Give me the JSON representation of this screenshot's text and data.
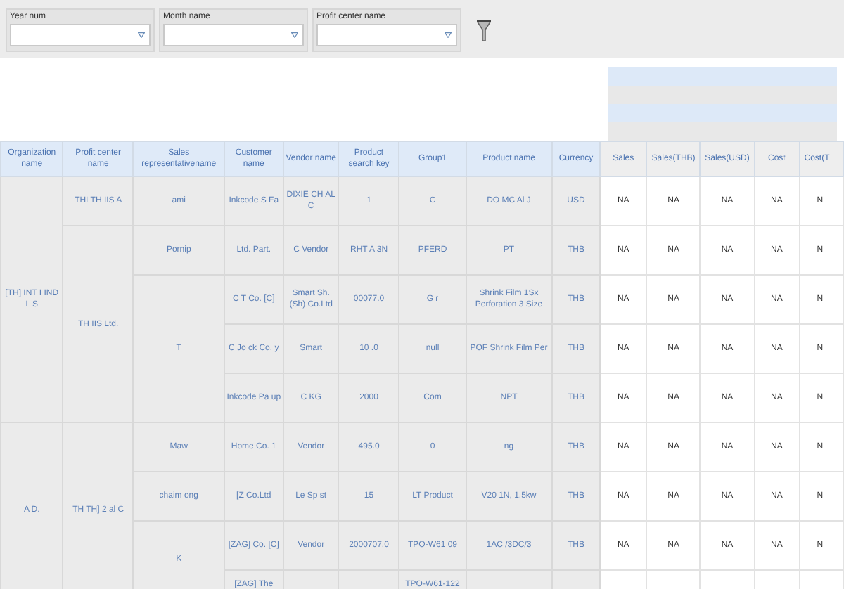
{
  "filters": [
    {
      "label": "Year num"
    },
    {
      "label": "Month name"
    },
    {
      "label": "Profit center name"
    }
  ],
  "table": {
    "columns": [
      "Organization name",
      "Profit center name",
      "Sales representativename",
      "Customer name",
      "Vendor name",
      "Product search key",
      "Group1",
      "Product name",
      "Currency",
      "Sales",
      "Sales(THB)",
      "Sales(USD)",
      "Cost",
      "Cost(T"
    ],
    "organizations": [
      {
        "name": "[TH] INT I IND L S",
        "profit_centers": [
          {
            "name": "THI TH IIS A",
            "sales_reps": [
              {
                "name": "ami",
                "lines": [
                  {
                    "customer": "Inkcode S Fa",
                    "vendor": "DIXIE CH AL C",
                    "search_key": "1",
                    "group1": "C",
                    "product": "DO MC Al J",
                    "currency": "USD",
                    "values": [
                      "NA",
                      "NA",
                      "NA",
                      "NA",
                      "N"
                    ]
                  }
                ]
              }
            ]
          },
          {
            "name": "TH IIS Ltd.",
            "sales_reps": [
              {
                "name": "Pornip",
                "lines": [
                  {
                    "customer": "Ltd. Part.",
                    "vendor": "C Vendor",
                    "search_key": "RHT A 3N",
                    "group1": "PFERD",
                    "product": "PT",
                    "currency": "THB",
                    "values": [
                      "NA",
                      "NA",
                      "NA",
                      "NA",
                      "N"
                    ]
                  }
                ]
              },
              {
                "name": "T",
                "lines": [
                  {
                    "customer": "C T Co. [C]",
                    "vendor": "Smart Sh. (Sh) Co.Ltd",
                    "search_key": "00077.0",
                    "group1": "G r",
                    "product": "Shrink Film 1Sx Perforation 3 Size",
                    "currency": "THB",
                    "values": [
                      "NA",
                      "NA",
                      "NA",
                      "NA",
                      "N"
                    ]
                  },
                  {
                    "customer": "C Jo ck Co. y",
                    "vendor": "Smart",
                    "search_key": "10 .0",
                    "group1": "null",
                    "product": "POF Shrink Film Per",
                    "currency": "THB",
                    "values": [
                      "NA",
                      "NA",
                      "NA",
                      "NA",
                      "N"
                    ]
                  },
                  {
                    "customer": "Inkcode Pa up",
                    "vendor": "C KG",
                    "search_key": "2000",
                    "group1": "Com",
                    "product": "NPT",
                    "currency": "THB",
                    "values": [
                      "NA",
                      "NA",
                      "NA",
                      "NA",
                      "N"
                    ]
                  }
                ]
              }
            ]
          }
        ]
      },
      {
        "name": "A D.",
        "profit_centers": [
          {
            "name": "TH TH] 2 al C",
            "sales_reps": [
              {
                "name": "Maw",
                "lines": [
                  {
                    "customer": "Home Co. 1",
                    "vendor": "Vendor",
                    "search_key": "495.0",
                    "group1": "0",
                    "product": "ng",
                    "currency": "THB",
                    "values": [
                      "NA",
                      "NA",
                      "NA",
                      "NA",
                      "N"
                    ]
                  }
                ]
              },
              {
                "name": "chaim ong",
                "lines": [
                  {
                    "customer": "[Z Co.Ltd",
                    "vendor": "Le Sp st",
                    "search_key": "15",
                    "group1": "LT Product",
                    "product": "V20 1N, 1.5kw",
                    "currency": "THB",
                    "values": [
                      "NA",
                      "NA",
                      "NA",
                      "NA",
                      "N"
                    ]
                  }
                ]
              },
              {
                "name": "K",
                "lines": [
                  {
                    "customer": "[ZAG] Co. [C]",
                    "vendor": "Vendor",
                    "search_key": "2000707.0",
                    "group1": "TPO-W61 09",
                    "product": "1AC /3DC/3",
                    "currency": "THB",
                    "values": [
                      "NA",
                      "NA",
                      "NA",
                      "NA",
                      "N"
                    ]
                  },
                  {
                    "customer": "[ZAG] The",
                    "group1": "TPO-W61-122"
                  }
                ]
              }
            ]
          }
        ]
      }
    ]
  }
}
